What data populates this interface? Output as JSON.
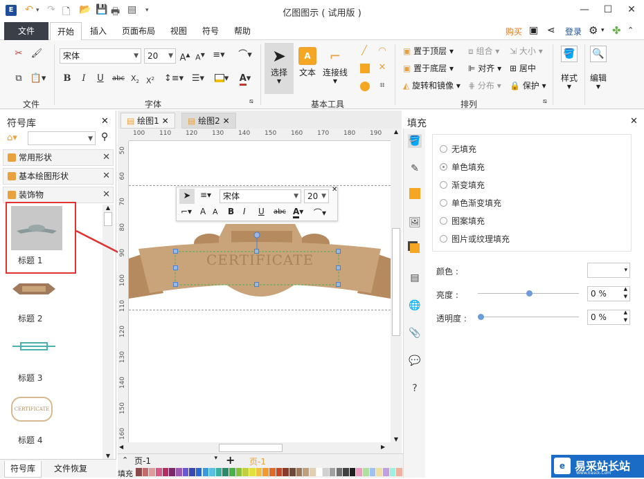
{
  "window": {
    "title": "亿图图示 ( 试用版 )",
    "minimize": "—",
    "maximize": "☐",
    "close": "✕"
  },
  "menu": {
    "file": "文件",
    "tabs": [
      "开始",
      "插入",
      "页面布局",
      "视图",
      "符号",
      "帮助"
    ],
    "buy": "购买",
    "login": "登录"
  },
  "ribbon": {
    "groups": {
      "file": "文件",
      "font": "字体",
      "basic_tools": "基本工具",
      "arrange": "排列"
    },
    "font_name": "宋体",
    "font_size": "20",
    "select": "选择",
    "text": "文本",
    "connector": "连接线",
    "text_icon_letter": "A",
    "arrange_items": {
      "bring_top": "置于顶层",
      "send_bottom": "置于底层",
      "rotate": "旋转和镜像",
      "group": "组合",
      "align": "对齐",
      "distribute": "分布",
      "size": "大小",
      "center": "居中",
      "protect": "保护"
    },
    "style": "样式",
    "edit": "编辑"
  },
  "library": {
    "title": "符号库",
    "sections": [
      "常用形状",
      "基本绘图形状",
      "装饰物"
    ],
    "shapes": [
      "标题 1",
      "标题 2",
      "标题 3",
      "标题 4"
    ],
    "shape4_text": "CERTIFICATE"
  },
  "doc_tabs": [
    "绘图1",
    "绘图2"
  ],
  "ruler_h": [
    "100",
    "110",
    "120",
    "130",
    "140",
    "150",
    "160",
    "170",
    "180",
    "190"
  ],
  "ruler_v": [
    "50",
    "60",
    "70",
    "80",
    "90",
    "100",
    "110",
    "120",
    "130",
    "140",
    "150",
    "160"
  ],
  "canvas": {
    "banner_text": "CERTIFICATE",
    "float_font": "宋体",
    "float_size": "20"
  },
  "fill_panel": {
    "title": "填充",
    "options": [
      "无填充",
      "单色填充",
      "渐变填充",
      "单色渐变填充",
      "图案填充",
      "图片或纹理填充"
    ],
    "selected": 1,
    "color_label": "颜色 :",
    "brightness_label": "亮度 :",
    "brightness_value": "0 %",
    "transparency_label": "透明度 :",
    "transparency_value": "0 %"
  },
  "status": {
    "page_combo": "页-1",
    "page_tab": "页-1",
    "fill_label": "填充"
  },
  "bottom_tabs": [
    "符号库",
    "文件恢复"
  ],
  "watermark": {
    "text": "易采站长站",
    "sub": "Www.Easck.Com"
  },
  "colors": {
    "accent": "#e8a13c",
    "banner_tan": "#c9a47a",
    "banner_dark": "#b48a5e",
    "file_tab": "#3a3f48",
    "arrow_red": "#e03030",
    "selection_blue": "#4a7fd0",
    "watermark_blue": "#1a6cc4"
  },
  "palette": [
    "#8b4a4a",
    "#c46a6a",
    "#e09a9a",
    "#d45a8a",
    "#b03060",
    "#7a2a6a",
    "#9a5ab0",
    "#6a5acd",
    "#3a4ab0",
    "#2a6ad0",
    "#3a9ae0",
    "#5ac0e0",
    "#3ab0a0",
    "#2a8a6a",
    "#4ab04a",
    "#8ac040",
    "#c0d040",
    "#e0e040",
    "#f0c040",
    "#f09a30",
    "#e06a2a",
    "#c04a2a",
    "#8a3a2a",
    "#6a4a3a",
    "#9a7a5a",
    "#c0a07a",
    "#e0d0b0",
    "#ffffff",
    "#d0d0d0",
    "#a0a0a0",
    "#707070",
    "#404040",
    "#202020",
    "#e8a0c0",
    "#b0e0a0",
    "#a0c0f0",
    "#f0e0a0",
    "#c0a0e0",
    "#a0f0e0",
    "#f0b0a0"
  ]
}
